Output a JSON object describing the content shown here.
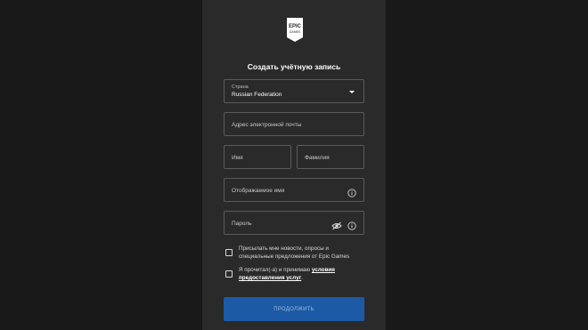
{
  "logo": {
    "line1": "EPIC",
    "line2": "GAMES"
  },
  "form": {
    "title": "Создать учётную запись",
    "country": {
      "label": "Страна",
      "value": "Russian Federation"
    },
    "email_placeholder": "Адрес электронной почты",
    "first_name_placeholder": "Имя",
    "last_name_placeholder": "Фамилия",
    "display_name_placeholder": "Отображаемое имя",
    "password_placeholder": "Пароль",
    "newsletter_line1": "Присылать мне новости, опросы и",
    "newsletter_line2": "специальные предложения от Epic Games",
    "terms_prefix": "Я прочитал(-а) и принимаю",
    "terms_link_1": "условия",
    "terms_link_2": "предоставления услуг",
    "terms_suffix": ".",
    "submit_label": "продолжить"
  },
  "colors": {
    "panel": "#2a2a2a",
    "background": "#191919",
    "button": "#1c5aa6"
  },
  "icons": {
    "logo": "epic-games-logo",
    "country_dropdown": "chevron-down-icon",
    "display_name_info": "info-icon",
    "password_visibility": "eye-slash-icon",
    "password_info": "info-icon"
  }
}
